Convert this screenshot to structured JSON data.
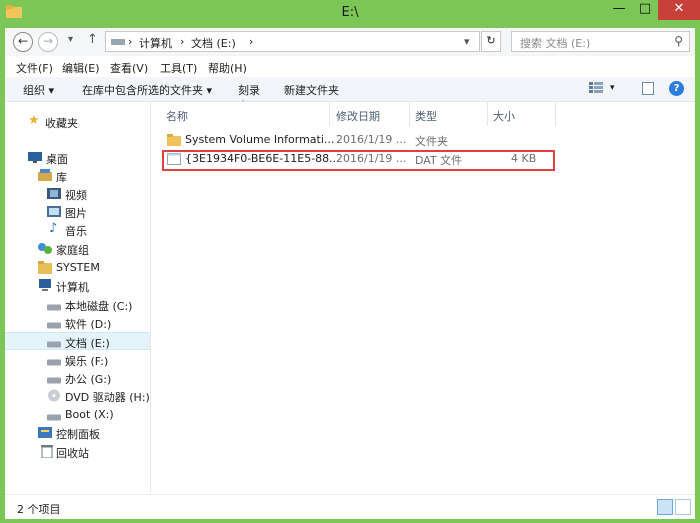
{
  "window": {
    "title": "E:\\"
  },
  "address": {
    "crumbs": [
      "计算机",
      "文档 (E:)"
    ],
    "search_placeholder": "搜索 文档 (E:)"
  },
  "menu": [
    "文件(F)",
    "编辑(E)",
    "查看(V)",
    "工具(T)",
    "帮助(H)"
  ],
  "toolbar": {
    "organize": "组织 ▾",
    "include": "在库中包含所选的文件夹 ▾",
    "burn": "刻录",
    "new_folder": "新建文件夹"
  },
  "nav": {
    "favorites": "收藏夹",
    "desktop": "桌面",
    "library": "库",
    "video": "视频",
    "pictures": "图片",
    "music": "音乐",
    "homegroup": "家庭组",
    "system": "SYSTEM",
    "computer": "计算机",
    "drive_c": "本地磁盘 (C:)",
    "drive_d": "软件 (D:)",
    "drive_e": "文档 (E:)",
    "drive_f": "娱乐 (F:)",
    "drive_g": "办公 (G:)",
    "drive_h": "DVD 驱动器 (H:) I",
    "drive_x": "Boot (X:)",
    "control_panel": "控制面板",
    "recycle": "回收站"
  },
  "columns": {
    "name": "名称",
    "date": "修改日期",
    "type": "类型",
    "size": "大小"
  },
  "files": [
    {
      "name": "System Volume Informati...",
      "date": "2016/1/19 ...",
      "type": "文件夹",
      "size": ""
    },
    {
      "name": "{3E1934F0-BE6E-11E5-88...",
      "date": "2016/1/19 ...",
      "type": "DAT 文件",
      "size": "4 KB"
    }
  ],
  "status": {
    "count": "2 个项目"
  },
  "colors": {
    "accent_frame": "#7cc657",
    "close": "#c7413a",
    "highlight_box": "#e04040"
  }
}
